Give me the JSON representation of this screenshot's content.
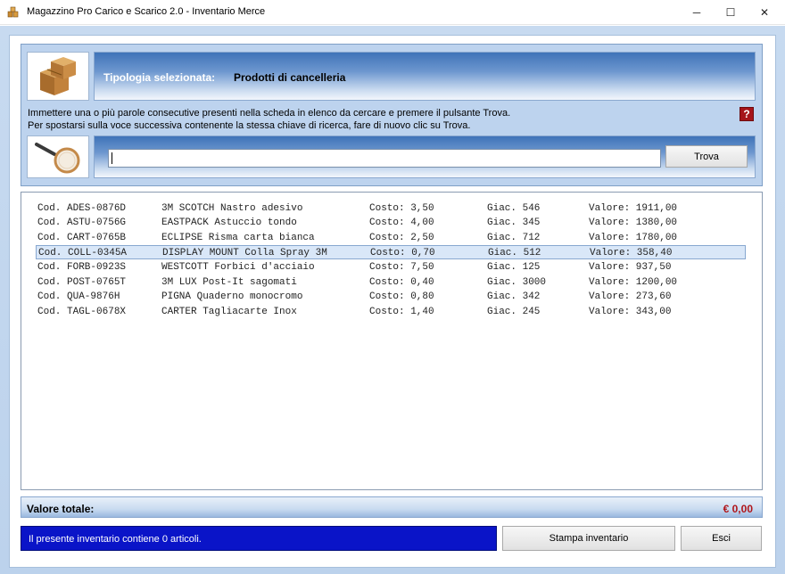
{
  "window": {
    "title": "Magazzino Pro Carico e Scarico 2.0 - Inventario Merce",
    "icon": "boxes-icon",
    "controls": {
      "minimize": "─",
      "maximize": "☐",
      "close": "✕"
    }
  },
  "category": {
    "label": "Tipologia selezionata:",
    "value": "Prodotti di cancelleria",
    "icon": "boxes-icon"
  },
  "instructions": {
    "line1": "Immettere una o più parole consecutive presenti nella scheda in elenco da cercare e premere il pulsante Trova.",
    "line2": "Per spostarsi sulla voce successiva contenente la stessa chiave di ricerca, fare di nuovo clic su Trova.",
    "help_symbol": "?"
  },
  "search": {
    "value": "",
    "button_label": "Trova",
    "icon": "magnifier-icon"
  },
  "inventory": {
    "selected_index": 3,
    "rows": [
      {
        "code": "Cod. ADES-0876D",
        "desc": "3M SCOTCH Nastro adesivo",
        "cost": "Costo: 3,50",
        "giac": "Giac. 546",
        "value": "Valore: 1911,00"
      },
      {
        "code": "Cod. ASTU-0756G",
        "desc": "EASTPACK Astuccio tondo",
        "cost": "Costo: 4,00",
        "giac": "Giac. 345",
        "value": "Valore: 1380,00"
      },
      {
        "code": "Cod. CART-0765B",
        "desc": "ECLIPSE Risma carta bianca",
        "cost": "Costo: 2,50",
        "giac": "Giac. 712",
        "value": "Valore: 1780,00"
      },
      {
        "code": "Cod. COLL-0345A",
        "desc": "DISPLAY MOUNT Colla Spray 3M",
        "cost": "Costo: 0,70",
        "giac": "Giac. 512",
        "value": "Valore: 358,40"
      },
      {
        "code": "Cod. FORB-0923S",
        "desc": "WESTCOTT Forbici d'acciaio",
        "cost": "Costo: 7,50",
        "giac": "Giac. 125",
        "value": "Valore: 937,50"
      },
      {
        "code": "Cod. POST-0765T",
        "desc": "3M LUX Post-It sagomati",
        "cost": "Costo: 0,40",
        "giac": "Giac. 3000",
        "value": "Valore: 1200,00"
      },
      {
        "code": "Cod. QUA-9876H",
        "desc": "PIGNA Quaderno monocromo",
        "cost": "Costo: 0,80",
        "giac": "Giac. 342",
        "value": "Valore: 273,60"
      },
      {
        "code": "Cod. TAGL-0678X",
        "desc": "CARTER Tagliacarte Inox",
        "cost": "Costo: 1,40",
        "giac": "Giac. 245",
        "value": "Valore: 343,00"
      }
    ]
  },
  "total": {
    "label": "Valore totale:",
    "value": "€ 0,00",
    "value_color": "#b0151a"
  },
  "status": {
    "text": "Il presente inventario contiene 0 articoli.",
    "color": "#0a14c8"
  },
  "buttons": {
    "print": "Stampa inventario",
    "exit": "Esci"
  }
}
